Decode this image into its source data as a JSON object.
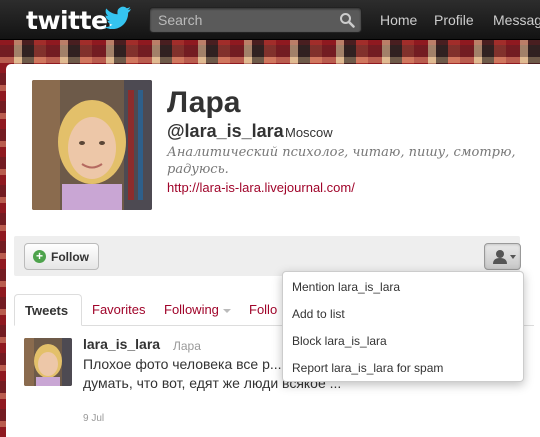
{
  "topbar": {
    "logo": "twitter",
    "search_placeholder": "Search",
    "nav": [
      "Home",
      "Profile",
      "Messages"
    ]
  },
  "profile": {
    "name": "Лара",
    "screen_name": "@lara_is_lara",
    "location": "Moscow",
    "bio": "Аналитический психолог, читаю, пишу, смотрю, радуюсь.",
    "url": "http://lara-is-lara.livejournal.com/"
  },
  "actions": {
    "follow_label": "Follow"
  },
  "menu": {
    "items": [
      "Mention lara_is_lara",
      "Add to list",
      "Block lara_is_lara",
      "Report lara_is_lara for spam"
    ]
  },
  "tabs": {
    "active": "Tweets",
    "favorites": "Favorites",
    "following": "Following",
    "followers": "Follo"
  },
  "tweet": {
    "user": "lara_is_lara",
    "fullname": "Лара",
    "text": "Плохое фото человека все р... плохое фото еды иногда заставляет думать, что вот, едят же люди всякое ...",
    "date": "9 Jul"
  },
  "colors": {
    "link": "#a0042a",
    "topbar": "#1f1f1f",
    "follow_icon": "#4ea34c"
  }
}
